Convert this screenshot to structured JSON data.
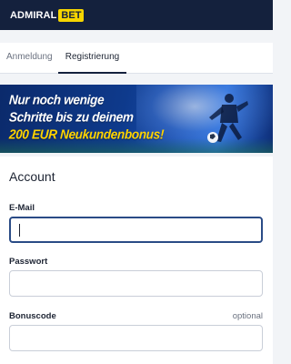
{
  "header": {
    "logo_admiral": "ADMIRAL",
    "logo_bet": "BET"
  },
  "tabs": [
    {
      "label": "Anmeldung",
      "active": false
    },
    {
      "label": "Registrierung",
      "active": true
    }
  ],
  "banner": {
    "line1": "Nur noch wenige",
    "line2": "Schritte bis zu deinem",
    "line3": "200 EUR Neukundenbonus!"
  },
  "form": {
    "section_title": "Account",
    "email": {
      "label": "E-Mail",
      "value": ""
    },
    "password": {
      "label": "Passwort",
      "value": ""
    },
    "bonuscode": {
      "label": "Bonuscode",
      "optional_label": "optional",
      "value": ""
    }
  },
  "colors": {
    "header_bg": "#14213d",
    "brand_yellow": "#f6d500",
    "focus_border": "#2a4b86",
    "page_bg": "#f2f4f7"
  }
}
